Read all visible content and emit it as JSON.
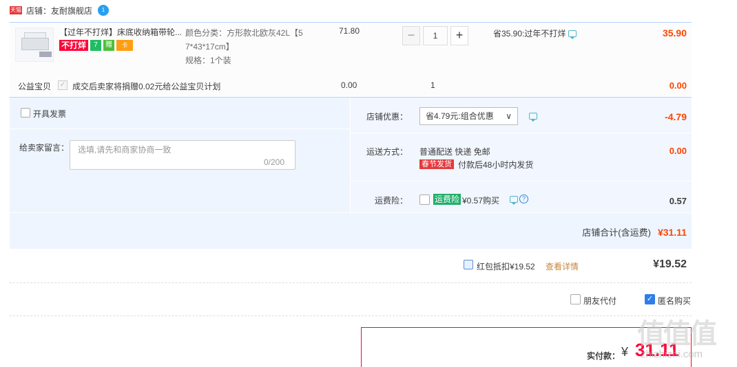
{
  "shop": {
    "badge": "天猫",
    "label": "店铺：友耐旗舰店",
    "ww": "1"
  },
  "item": {
    "title": "【过年不打烊】床底收纳箱带轮...",
    "tag_nodaz": "不打烊",
    "tag_7": "7",
    "tag_y": "赠",
    "tag_card": "卡",
    "sku_line1": "颜色分类：方形款北欧灰42L【5",
    "sku_line2": "7*43*17cm】",
    "sku_line3": "规格：1个装",
    "price": "71.80",
    "qty_minus": "−",
    "qty": "1",
    "qty_plus": "+",
    "promo": "省35.90:过年不打烊",
    "subtotal": "35.90"
  },
  "charity": {
    "label": "公益宝贝",
    "check": "✓",
    "text": "成交后卖家将捐赠0.02元给公益宝贝计划",
    "price": "0.00",
    "qty": "1",
    "total": "0.00"
  },
  "invoice": {
    "label": "开具发票"
  },
  "message": {
    "label": "给卖家留言：",
    "placeholder": "选填,请先和商家协商一致",
    "count": "0/200"
  },
  "discount": {
    "label": "店铺优惠：",
    "value": "省4.79元:组合优惠",
    "arrow": "∨",
    "amount": "-4.79"
  },
  "shipping": {
    "label": "运送方式：",
    "value": "普通配送 快递 免邮",
    "tag": "春节发货",
    "sub": "付款后48小时内发货",
    "amount": "0.00"
  },
  "insurance": {
    "label": "运费险：",
    "tag": "运费险",
    "text": "¥0.57购买",
    "q": "?",
    "amount": "0.57"
  },
  "shop_total": {
    "label": "店铺合计(含运费)",
    "amount": "¥31.11"
  },
  "redpacket": {
    "text": "红包抵扣¥19.52",
    "link": "查看详情",
    "amount": "¥19.52"
  },
  "options": {
    "friend": "朋友代付",
    "anon": "匿名购买",
    "anon_check": "✓"
  },
  "pay": {
    "label": "实付款：",
    "currency": "¥",
    "amount": "31.11"
  },
  "watermark": {
    "main": "值值值",
    "sub": "zhizhizhi.com"
  }
}
